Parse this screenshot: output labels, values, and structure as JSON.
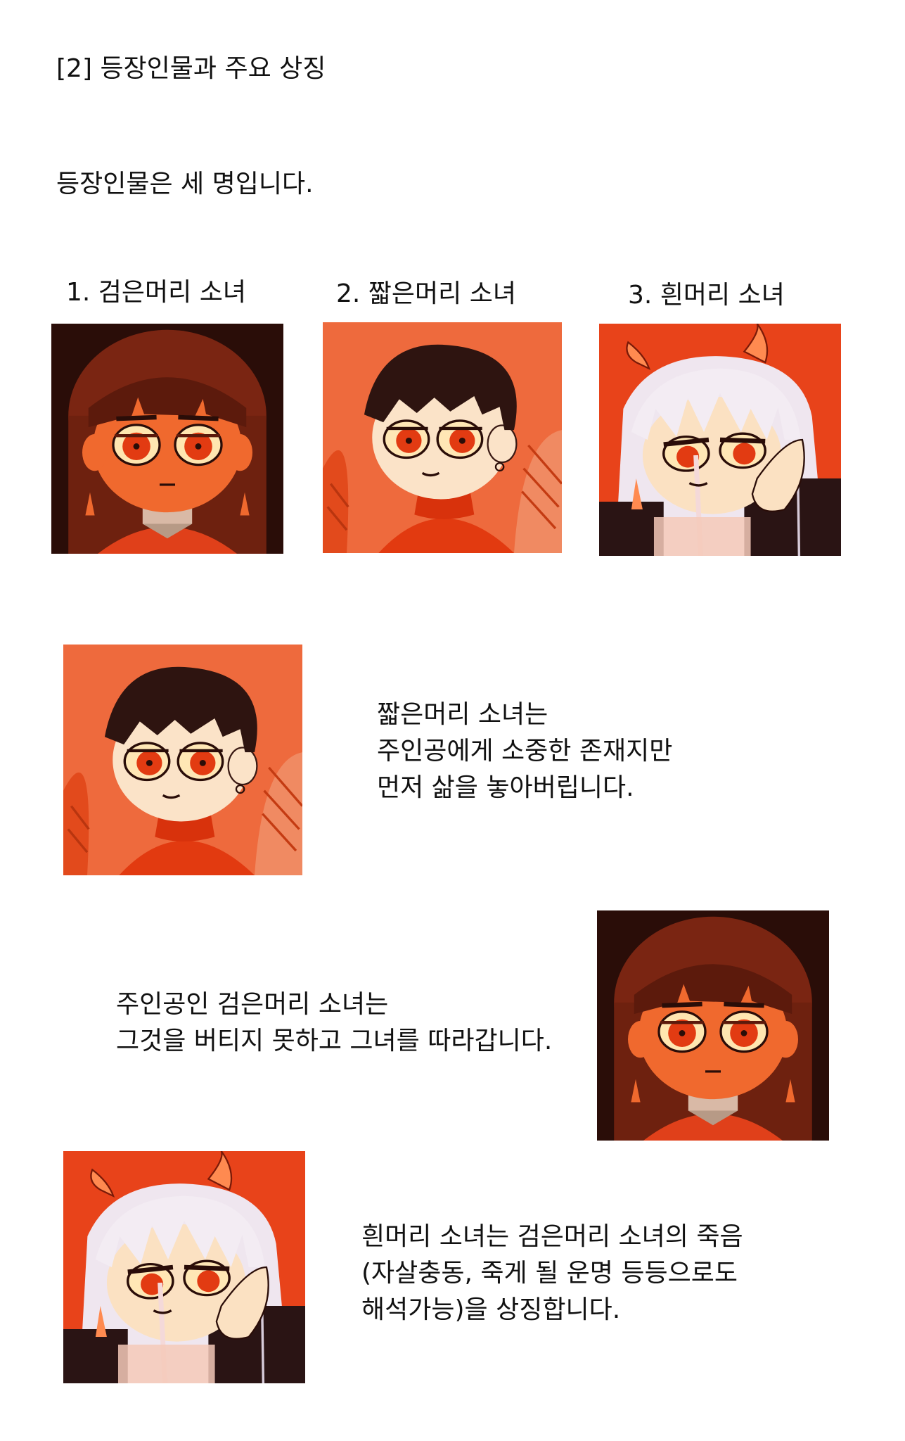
{
  "heading": "[2] 등장인물과 주요 상징",
  "intro": "등장인물은 세 명입니다.",
  "characters": [
    {
      "label": "1. 검은머리 소녀"
    },
    {
      "label": "2. 짧은머리 소녀"
    },
    {
      "label": "3. 흰머리 소녀"
    }
  ],
  "sections": [
    {
      "lines": [
        "짧은머리 소녀는",
        "주인공에게 소중한 존재지만",
        "먼저 삶을 놓아버립니다."
      ]
    },
    {
      "lines": [
        "주인공인 검은머리 소녀는",
        "그것을 버티지 못하고 그녀를 따라갑니다."
      ]
    },
    {
      "lines": [
        "흰머리 소녀는 검은머리 소녀의 죽음",
        "(자살충동, 죽게 될 운명 등등으로도",
        "해석가능)을 상징합니다."
      ]
    }
  ]
}
